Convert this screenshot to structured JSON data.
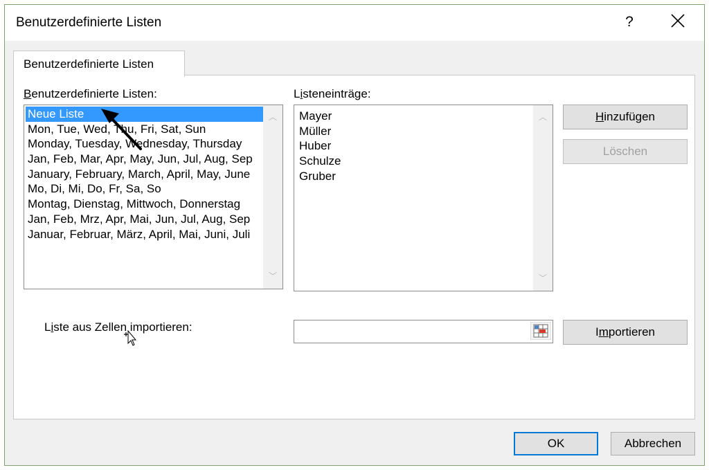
{
  "dialog": {
    "title": "Benutzerdefinierte Listen",
    "help_label": "?"
  },
  "tab": {
    "label": "Benutzerdefinierte Listen"
  },
  "custom_lists": {
    "label_first": "B",
    "label_rest": "enutzerdefinierte Listen:",
    "items": [
      "Neue Liste",
      "Mon, Tue, Wed, Thu, Fri, Sat, Sun",
      "Monday, Tuesday, Wednesday, Thursday",
      "Jan, Feb, Mar, Apr, May, Jun, Jul, Aug, Sep",
      "January, February, March, April, May, June",
      "Mo, Di, Mi, Do, Fr, Sa, So",
      "Montag, Dienstag, Mittwoch, Donnerstag",
      "Jan, Feb, Mrz, Apr, Mai, Jun, Jul, Aug, Sep",
      "Januar, Februar, März, April, Mai, Juni, Juli"
    ],
    "selected_index": 0
  },
  "entries": {
    "label_first": "L",
    "label_u": "i",
    "label_rest": "steneinträge:",
    "lines": [
      "Mayer",
      "Müller",
      "Huber",
      "Schulze",
      "Gruber"
    ]
  },
  "buttons": {
    "add_u": "H",
    "add_rest": "inzufügen",
    "delete": "Löschen",
    "import_pre": "I",
    "import_u": "m",
    "import_rest": "portieren",
    "ok": "OK",
    "cancel": "Abbrechen"
  },
  "import": {
    "label_pre": "L",
    "label_u": "i",
    "label_rest": "ste aus Zellen importieren:",
    "value": ""
  },
  "colors": {
    "selection": "#3399ff",
    "default_button_border": "#0078d7",
    "dialog_bg": "#f0f0f0"
  }
}
